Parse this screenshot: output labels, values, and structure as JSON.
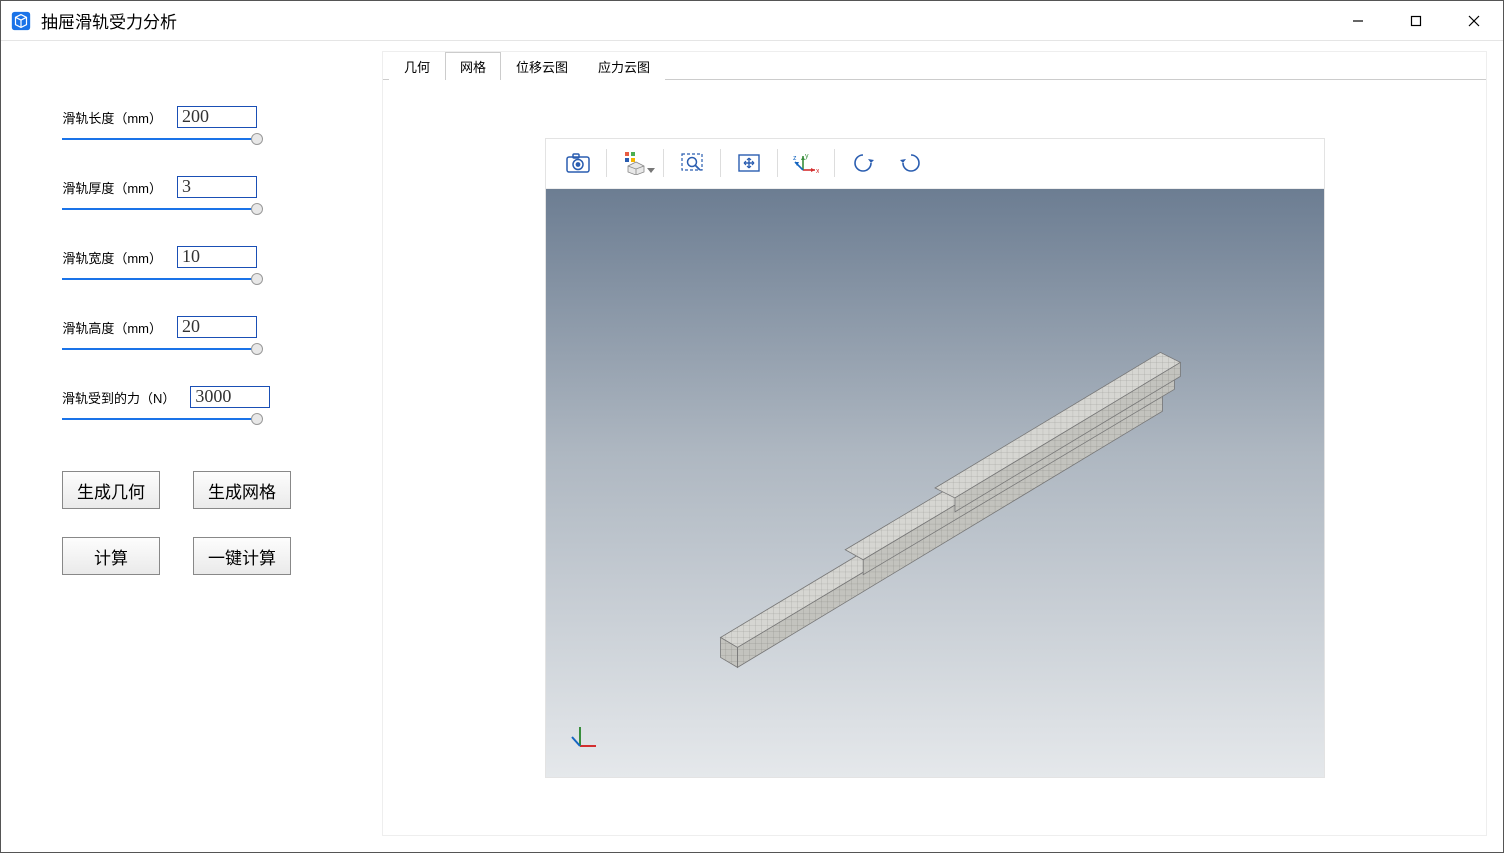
{
  "app": {
    "title": "抽屉滑轨受力分析"
  },
  "params": {
    "length": {
      "label": "滑轨长度（mm）",
      "value": "200"
    },
    "thick": {
      "label": "滑轨厚度（mm）",
      "value": "3"
    },
    "width": {
      "label": "滑轨宽度（mm）",
      "value": "10"
    },
    "height": {
      "label": "滑轨高度（mm）",
      "value": "20"
    },
    "force": {
      "label": "滑轨受到的力（N）",
      "value": "3000"
    }
  },
  "buttons": {
    "gen_geom": "生成几何",
    "gen_mesh": "生成网格",
    "compute": "计算",
    "one_click": "一键计算"
  },
  "tabs": {
    "geom": "几何",
    "mesh": "网格",
    "disp": "位移云图",
    "stress": "应力云图"
  }
}
